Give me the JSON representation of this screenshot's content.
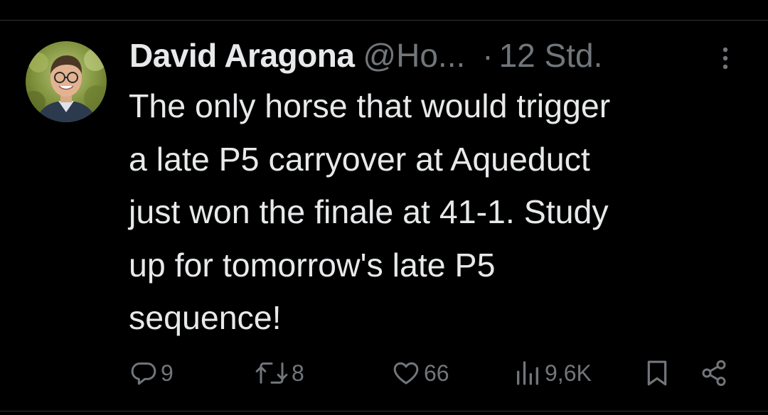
{
  "tweet": {
    "author_name": "David Aragona",
    "handle": "@Ho...",
    "separator": "·",
    "time": "12 Std.",
    "text": "The only horse that would trigger\na late P5 carryover at Aqueduct\njust won the finale at 41-1. Study\nup for tomorrow's late P5\nsequence!"
  },
  "actions": {
    "replies": "9",
    "reposts": "8",
    "likes": "66",
    "views": "9,6K"
  },
  "icons": {
    "more": "more-vertical-icon",
    "reply": "reply-icon",
    "repost": "repost-icon",
    "like": "heart-icon",
    "views": "views-icon",
    "bookmark": "bookmark-icon",
    "share": "share-icon"
  },
  "colors": {
    "background": "#000000",
    "text": "#e7e9ea",
    "secondary": "#71767b",
    "divider": "#2f3336"
  }
}
